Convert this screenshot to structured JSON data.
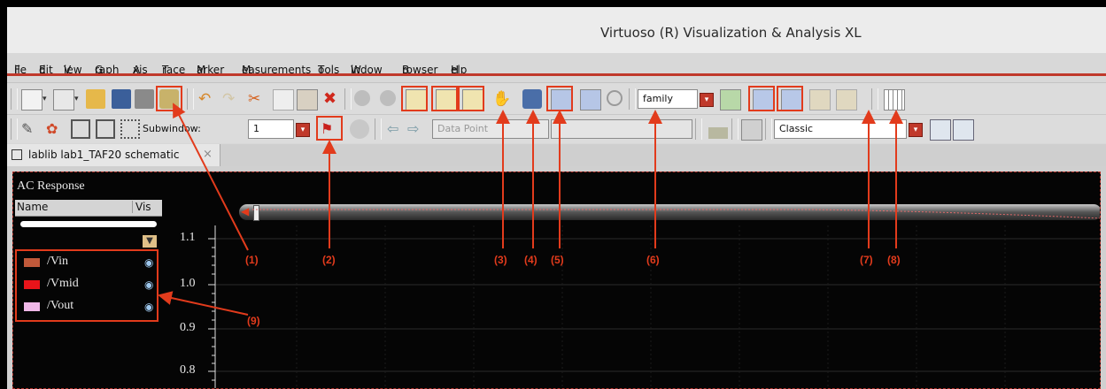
{
  "window": {
    "title": "Virtuoso (R) Visualization & Analysis XL"
  },
  "menu": {
    "items": [
      {
        "first": "F",
        "rest": "ile"
      },
      {
        "first": "E",
        "rest": "dit"
      },
      {
        "first": "V",
        "rest": "iew"
      },
      {
        "first": "G",
        "rest": "raph"
      },
      {
        "first": "A",
        "rest": "xis"
      },
      {
        "first": "T",
        "rest": "race"
      },
      {
        "first": "M",
        "rest": "arker"
      },
      {
        "first": "M",
        "rest": "easurements",
        "pre": ""
      },
      {
        "first": "T",
        "rest": "ools"
      },
      {
        "first": "W",
        "rest": "indow"
      },
      {
        "first": "B",
        "rest": "rowser"
      },
      {
        "first": "H",
        "rest": "elp"
      }
    ]
  },
  "toolbar1": {
    "family_combo": "family"
  },
  "toolbar2": {
    "subwindow_label": "Subwindow:",
    "subwindow_value": "1",
    "data_point": "Data Point",
    "style_combo": "Classic"
  },
  "tab": {
    "title": "lablib lab1_TAF20 schematic",
    "close": "×"
  },
  "plot": {
    "title": "AC Response",
    "browser_header": {
      "name": "Name",
      "vis": "Vis"
    },
    "signals": [
      {
        "name": "/Vin",
        "color": "#c0593a"
      },
      {
        "name": "/Vmid",
        "color": "#e8141a"
      },
      {
        "name": "/Vout",
        "color": "#f0b8e8"
      }
    ],
    "y_ticks": [
      "1.1",
      "1.0",
      "0.9",
      "0.8"
    ]
  },
  "annotations": [
    "(1)",
    "(2)",
    "(3)",
    "(4)",
    "(5)",
    "(6)",
    "(7)",
    "(8)",
    "(9)"
  ],
  "colors": {
    "accent": "#e23b1c",
    "plot_bg": "#050505"
  }
}
